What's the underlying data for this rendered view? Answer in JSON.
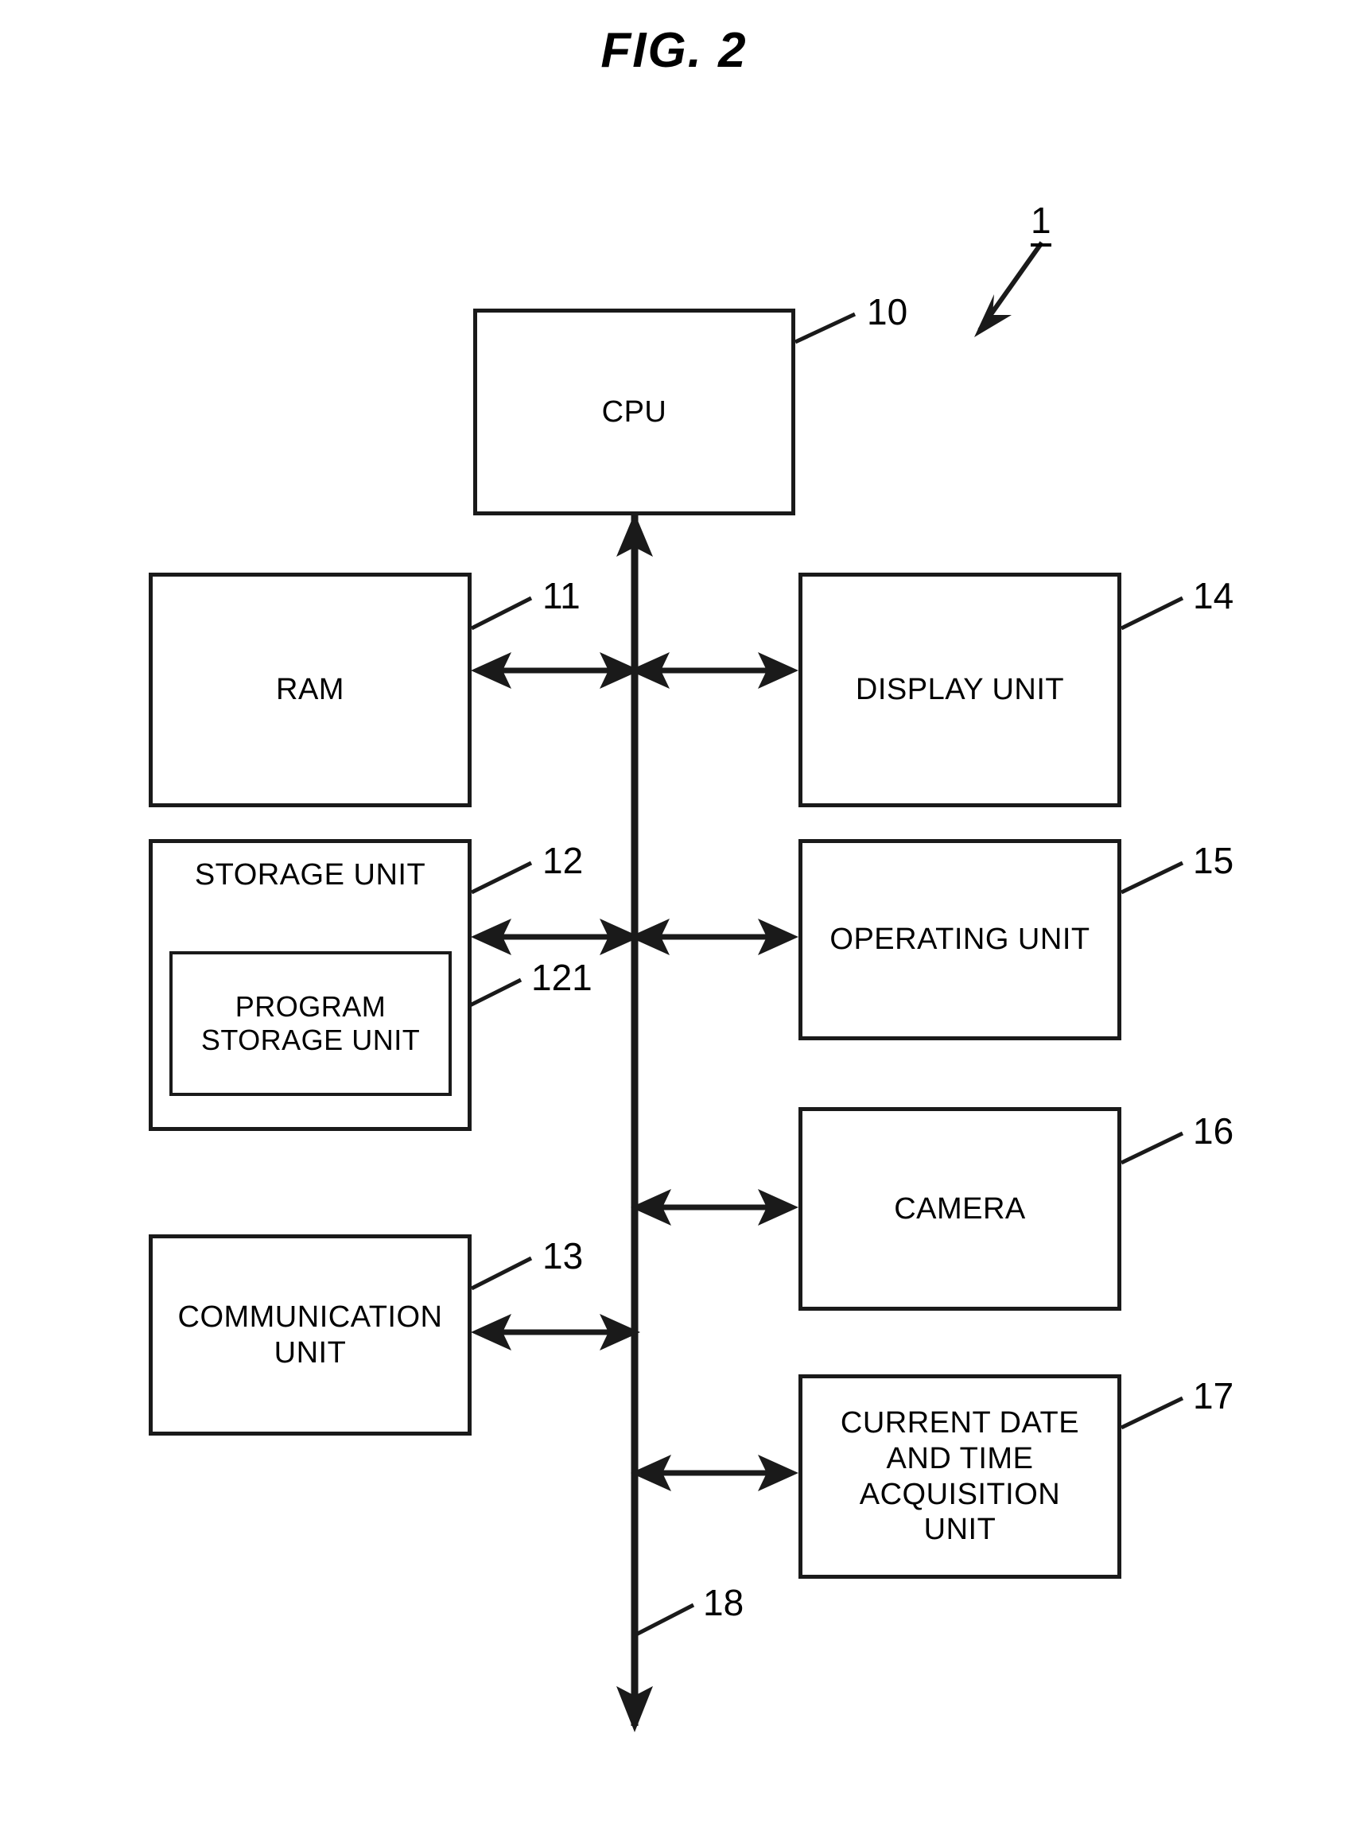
{
  "figure": {
    "title": "FIG. 2",
    "system_ref": "1",
    "bus_ref": "18"
  },
  "blocks": [
    {
      "key": "cpu",
      "label": "CPU",
      "ref": "10"
    },
    {
      "key": "ram",
      "label": "RAM",
      "ref": "11"
    },
    {
      "key": "display",
      "label": "DISPLAY UNIT",
      "ref": "14"
    },
    {
      "key": "storage",
      "label": "STORAGE UNIT",
      "ref": "12"
    },
    {
      "key": "program",
      "label": "PROGRAM\nSTORAGE UNIT",
      "ref": "121"
    },
    {
      "key": "operating",
      "label": "OPERATING UNIT",
      "ref": "15"
    },
    {
      "key": "camera",
      "label": "CAMERA",
      "ref": "16"
    },
    {
      "key": "comm",
      "label": "COMMUNICATION\nUNIT",
      "ref": "13"
    },
    {
      "key": "datetime",
      "label": "CURRENT DATE\nAND TIME\nACQUISITION\nUNIT",
      "ref": "17"
    }
  ],
  "colors": {
    "line": "#1a1a1a",
    "background": "#ffffff",
    "text": "#000000"
  }
}
